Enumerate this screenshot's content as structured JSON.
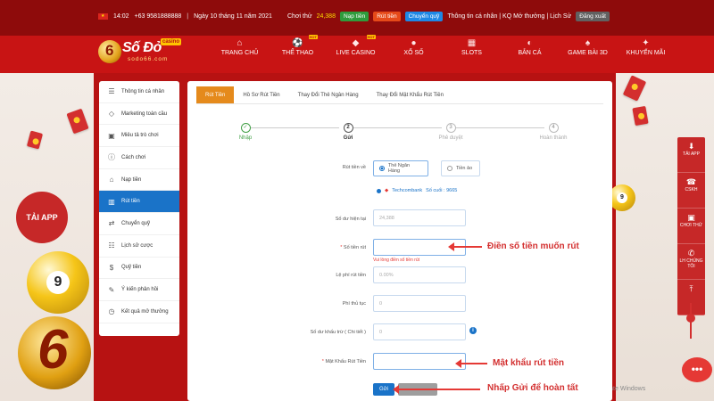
{
  "topbar": {
    "time": "14:02",
    "phone": "+63 9581888888",
    "date": "Ngày 10 tháng 11 năm 2021",
    "balance_label": "Chơi thử",
    "balance_value": "24,388",
    "deposit": "Nạp tiền",
    "withdraw": "Rút tiền",
    "transfer": "Chuyển quỹ",
    "account_links": "Thông tin cá nhân | KQ Mở thưởng | Lịch Sử",
    "logout": "Đăng xuất"
  },
  "logo": {
    "name": "Số Đỏ",
    "badge": "casino",
    "url": "sodo66.com"
  },
  "nav": [
    {
      "label": "TRANG CHỦ",
      "icon": "home-icon",
      "glyph": "⌂",
      "hot": false
    },
    {
      "label": "THỂ THAO",
      "icon": "soccer-icon",
      "glyph": "⚽",
      "hot": true
    },
    {
      "label": "LIVE CASINO",
      "icon": "diamond-icon",
      "glyph": "◆",
      "hot": true
    },
    {
      "label": "XỔ SỐ",
      "icon": "lottery-icon",
      "glyph": "●",
      "hot": false
    },
    {
      "label": "SLOTS",
      "icon": "slots-icon",
      "glyph": "▦",
      "hot": false
    },
    {
      "label": "BẮN CÁ",
      "icon": "fish-icon",
      "glyph": "◐",
      "hot": false
    },
    {
      "label": "GAME BÀI 3D",
      "icon": "cards-icon",
      "glyph": "♠",
      "hot": false
    },
    {
      "label": "KHUYẾN MÃI",
      "icon": "gift-icon",
      "glyph": "✦",
      "hot": false
    }
  ],
  "hot_badge": "HOT",
  "sidebar": [
    {
      "label": "Thông tin cá nhân",
      "icon": "user-card-icon",
      "glyph": "☰",
      "active": false
    },
    {
      "label": "Marketing toàn cầu",
      "icon": "diamond-icon",
      "glyph": "◇",
      "active": false
    },
    {
      "label": "Miêu tả trò chơi",
      "icon": "gamepad-icon",
      "glyph": "▣",
      "active": false
    },
    {
      "label": "Cách chơi",
      "icon": "info-icon",
      "glyph": "ⓘ",
      "active": false
    },
    {
      "label": "Nạp tiền",
      "icon": "piggy-icon",
      "glyph": "⌂",
      "active": false
    },
    {
      "label": "Rút tiền",
      "icon": "bank-icon",
      "glyph": "▥",
      "active": true
    },
    {
      "label": "Chuyển quỹ",
      "icon": "transfer-icon",
      "glyph": "⇄",
      "active": false
    },
    {
      "label": "Lịch sử cược",
      "icon": "history-list-icon",
      "glyph": "☷",
      "active": false
    },
    {
      "label": "Quỹ tiền",
      "icon": "wallet-icon",
      "glyph": "$",
      "active": false
    },
    {
      "label": "Ý kiến phản hồi",
      "icon": "feedback-icon",
      "glyph": "✎",
      "active": false
    },
    {
      "label": "Kết quả mở thưởng",
      "icon": "clock-icon",
      "glyph": "◷",
      "active": false
    }
  ],
  "tabs": [
    {
      "label": "Rút Tiền",
      "active": true
    },
    {
      "label": "Hồ Sơ Rút Tiền",
      "active": false
    },
    {
      "label": "Thay Đổi Thẻ Ngân Hàng",
      "active": false
    },
    {
      "label": "Thay Đổi Mật Khẩu Rút Tiền",
      "active": false
    }
  ],
  "steps": [
    {
      "label": "Nhập",
      "mark": "✓",
      "state": "done"
    },
    {
      "label": "Gửi",
      "mark": "2",
      "state": "current"
    },
    {
      "label": "Phê duyệt",
      "mark": "3",
      "state": "pending"
    },
    {
      "label": "Hoàn thành",
      "mark": "4",
      "state": "pending"
    }
  ],
  "form": {
    "withdraw_to_label": "Rút tiền về",
    "option_bank": "Thẻ Ngân Hàng",
    "option_crypto": "Tiền ảo",
    "bank_name": "Techcombank",
    "bank_tail": "Số cuối : 9665",
    "balance_label": "Số dư hiện tại",
    "balance_value": "24,388",
    "amount_label": "Số tiền rút",
    "amount_required": "*",
    "amount_error": "Vui lòng điền số tiền rút",
    "fee_label": "Lệ phí rút tiền",
    "fee_value": "0.00%",
    "proc_label": "Phí thủ tục",
    "proc_value": "0",
    "deduct_label": "Số dư khấu trừ ( Chi tiết )",
    "deduct_value": "0",
    "password_label": "Mật Khẩu Rút Tiền",
    "password_required": "*",
    "submit": "Gửi"
  },
  "annotations": {
    "amount_note": "Điền số tiền muốn rút",
    "password_note": "Mật khẩu rút tiền",
    "submit_note": "Nhấp Gửi để hoàn tất"
  },
  "side_panel": [
    {
      "label": "TẢI APP",
      "icon": "download-icon",
      "glyph": "⬇"
    },
    {
      "label": "CSKH",
      "icon": "support-icon",
      "glyph": "☎"
    },
    {
      "label": "CHƠI THỬ",
      "icon": "gamepad-icon",
      "glyph": "▣"
    },
    {
      "label": "LH CHÚNG TÔI",
      "icon": "phone-icon",
      "glyph": "✆"
    },
    {
      "label": "",
      "icon": "scroll-top-icon",
      "glyph": "⤒"
    }
  ],
  "tai_app_badge": "TẢI APP",
  "ball_number": "9",
  "activate_text": "Activate Windows",
  "colors": {
    "brand_red": "#c81414",
    "accent_blue": "#1a73c8",
    "tab_orange": "#e58a1c",
    "note_red": "#d32f2f"
  }
}
